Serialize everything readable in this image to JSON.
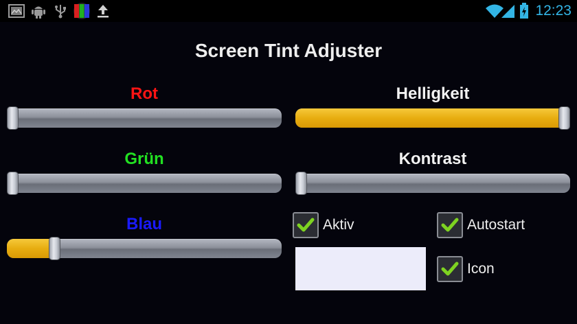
{
  "status_bar": {
    "left_icons": [
      "gallery-icon",
      "android-debug-icon",
      "usb-icon",
      "rgb-app-icon",
      "upload-icon"
    ],
    "right_icons": [
      "wifi-icon",
      "signal-icon",
      "battery-charging-icon"
    ],
    "time": "12:23"
  },
  "app": {
    "title": "Screen Tint Adjuster"
  },
  "sliders": {
    "rot": {
      "label": "Rot",
      "color": "#ff1414",
      "value": 0.0
    },
    "gruen": {
      "label": "Grün",
      "color": "#22e022",
      "value": 0.0
    },
    "blau": {
      "label": "Blau",
      "color": "#1a1aff",
      "value": 0.16
    },
    "helligkeit": {
      "label": "Helligkeit",
      "value": 1.0
    },
    "kontrast": {
      "label": "Kontrast",
      "value": 0.0
    }
  },
  "checkboxes": {
    "aktiv": {
      "label": "Aktiv",
      "checked": true
    },
    "autostart": {
      "label": "Autostart",
      "checked": true
    },
    "icon": {
      "label": "Icon",
      "checked": true
    }
  },
  "colors": {
    "accent_fill": "#e8ad10",
    "check_green": "#7ed321",
    "time_blue": "#33b5e5",
    "preview_swatch": "#ececfa"
  }
}
